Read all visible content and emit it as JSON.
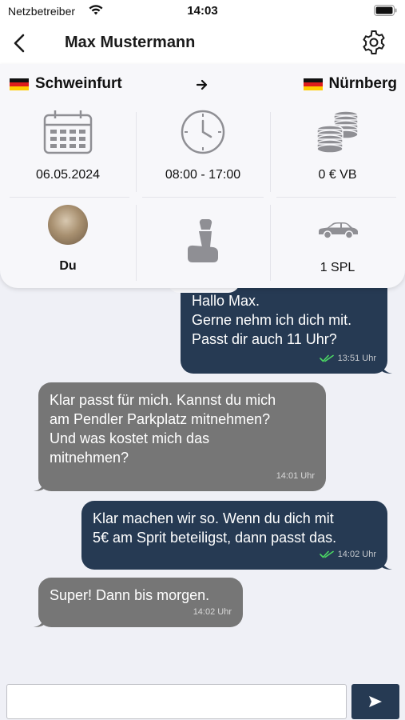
{
  "status_bar": {
    "carrier": "Netzbetreiber",
    "time": "14:03"
  },
  "nav": {
    "title": "Max Mustermann",
    "back_icon": "chevron-left-icon",
    "settings_icon": "gear-icon"
  },
  "ride": {
    "from": "Schweinfurt",
    "to": "Nürnberg",
    "date": "06.05.2024",
    "time_range": "08:00 - 17:00",
    "price": "0 € VB",
    "driver": "Du",
    "seats": "1 SPL"
  },
  "messages": [
    {
      "direction": "out",
      "lines": [
        "Hallo Max.",
        "Gerne nehm ich dich mit.",
        "Passt dir auch 11 Uhr?"
      ],
      "time": "13:51 Uhr",
      "read": true
    },
    {
      "direction": "in",
      "lines": [
        "Klar passt für mich. Kannst du mich",
        "am Pendler Parkplatz mitnehmen?",
        "Und was kostet mich das",
        "mitnehmen?"
      ],
      "time": "14:01 Uhr"
    },
    {
      "direction": "out",
      "lines": [
        "Klar machen wir so. Wenn du dich mit",
        "5€ am Sprit beteiligst, dann passt das."
      ],
      "time": "14:02 Uhr",
      "read": true
    },
    {
      "direction": "in",
      "lines": [
        "Super! Dann bis morgen."
      ],
      "time": "14:02 Uhr"
    }
  ],
  "colors": {
    "outgoing_bubble": "#263a53",
    "incoming_bubble": "#767676",
    "read_check": "#4cd964",
    "background": "#eff0f6"
  },
  "composer": {
    "value": "",
    "send_icon": "send-arrow-icon"
  }
}
